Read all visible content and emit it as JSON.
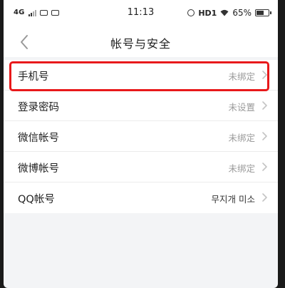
{
  "status_bar": {
    "carrier": "4G",
    "time": "11:13",
    "hd": "HD1",
    "battery": "65%",
    "battery_level": 0.65
  },
  "nav": {
    "title": "帐号与安全"
  },
  "settings": {
    "items": [
      {
        "label": "手机号",
        "value": "未绑定",
        "highlighted": true
      },
      {
        "label": "登录密码",
        "value": "未设置"
      },
      {
        "label": "微信帐号",
        "value": "未绑定"
      },
      {
        "label": "微博帐号",
        "value": "未绑定"
      },
      {
        "label": "QQ帐号",
        "value": "무지개 미소"
      }
    ]
  },
  "colors": {
    "highlight": "#e8191b",
    "background": "#f3f4f6"
  }
}
